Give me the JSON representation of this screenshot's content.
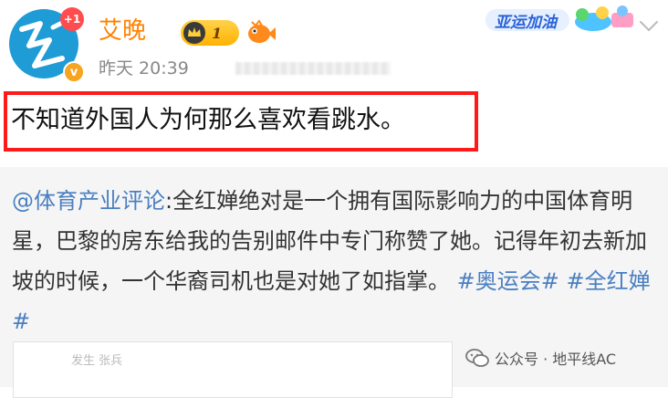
{
  "post": {
    "author": {
      "name": "艾晚",
      "level": "1",
      "notification_badge": "+1",
      "verified_mark": "v"
    },
    "timestamp": "昨天 20:39",
    "event_banner": "亚运加油",
    "text": "不知道外国人为何那么喜欢看跳水。"
  },
  "repost": {
    "mention": "@体育产业评论",
    "body": ":全红婵绝对是一个拥有国际影响力的中国体育明星，巴黎的房东给我的告别邮件中专门称赞了她。记得年初去新加坡的时候，一个华裔司机也是对她了如指掌。",
    "tags": [
      "#奥运会#",
      "#全红婵#"
    ],
    "card_caption": "发生 张兵"
  },
  "watermark": {
    "text": "公众号 · 地平线AC"
  },
  "colors": {
    "username": "#ff8200",
    "link": "#4a7fc1",
    "highlight_border": "#ff1a1a",
    "repost_bg": "#f5f5f5"
  },
  "icons": [
    "avatar",
    "crown-icon",
    "fish-icon",
    "chevron-down-icon",
    "wechat-icon"
  ]
}
